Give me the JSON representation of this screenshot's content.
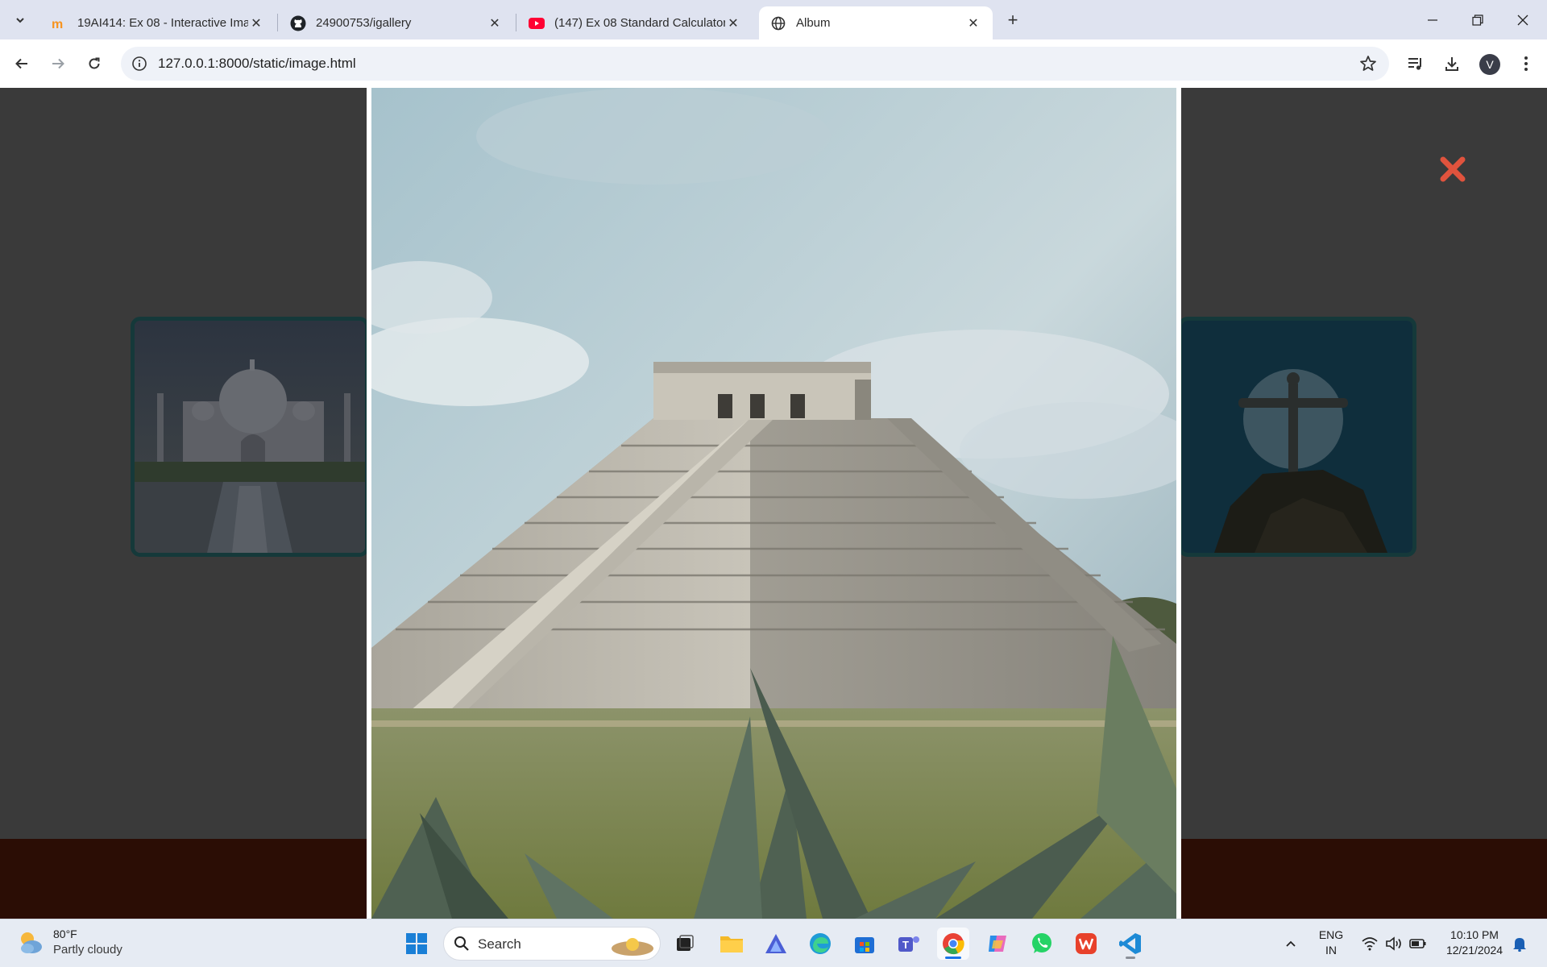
{
  "browser": {
    "tabs": [
      {
        "title": "19AI414: Ex 08 - Interactive Ima",
        "favicon": "moodle-icon",
        "active": false
      },
      {
        "title": "24900753/igallery",
        "favicon": "github-icon",
        "active": false
      },
      {
        "title": "(147) Ex 08 Standard Calculator",
        "favicon": "youtube-icon",
        "active": false
      },
      {
        "title": "Album",
        "favicon": "globe-icon",
        "active": true
      }
    ],
    "url": "127.0.0.1:8000/static/image.html",
    "profile_initial": "V"
  },
  "page": {
    "viewer": {
      "main_image": "Chichen Itza pyramid under a pale blue sky with agave leaves in the foreground",
      "prev_thumbnail": "Taj Mahal with reflecting pool",
      "next_thumbnail": "Christ the Redeemer statue in front of the moon",
      "close_color": "#e0533d"
    },
    "colors": {
      "background": "#3a3a3a",
      "footer_band": "#2b0d05",
      "thumbnail_border": "#15393a"
    }
  },
  "taskbar": {
    "weather": {
      "temp": "80°F",
      "condition": "Partly cloudy"
    },
    "search_label": "Search",
    "language": {
      "line1": "ENG",
      "line2": "IN"
    },
    "clock": {
      "time": "10:10 PM",
      "date": "12/21/2024"
    }
  }
}
